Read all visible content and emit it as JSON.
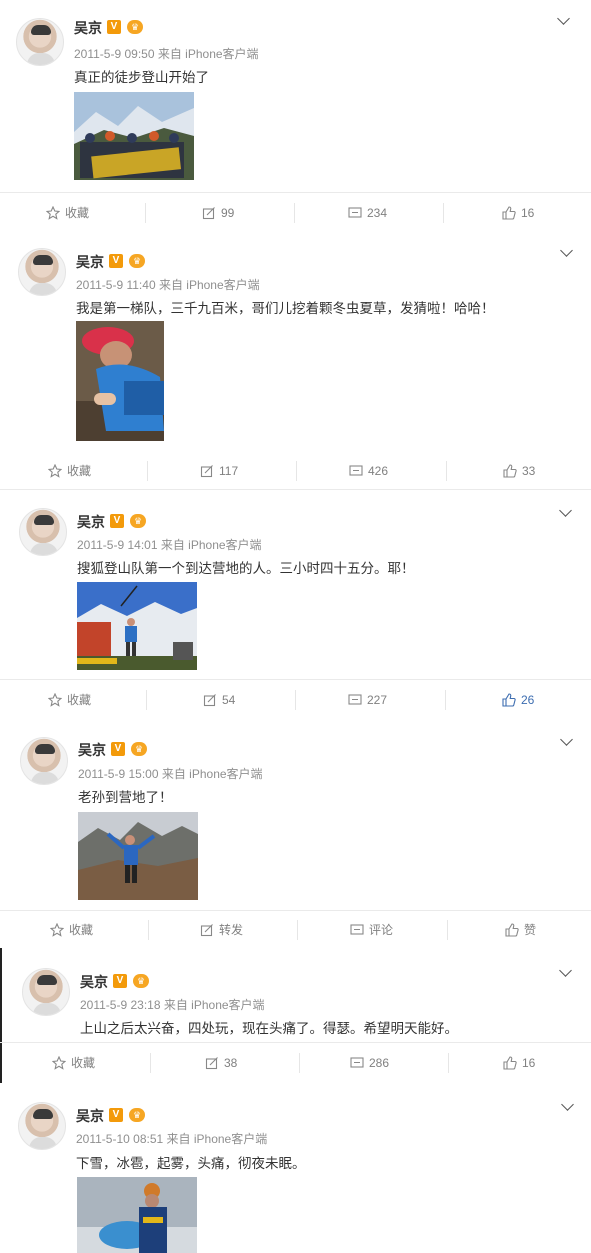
{
  "author_name": "吴京",
  "v_badge": "V",
  "crown_badge": "♛",
  "actions": {
    "favorite_label": "收藏",
    "repost_label": "转发",
    "comment_label": "评论",
    "like_label": "赞"
  },
  "colors": {
    "accent_blue": "#3d6db0",
    "v_badge": "#f39a0a",
    "meta_gray": "#8f8f8f"
  },
  "icons": [
    "star-icon",
    "repost-icon",
    "comment-icon",
    "like-icon",
    "chevron-down-icon",
    "verified-v-icon",
    "vip-crown-icon"
  ],
  "posts": [
    {
      "meta": "2011-5-9 09:50 来自 iPhone客户端",
      "text": "真正的徒步登山开始了",
      "repost": "99",
      "comment": "234",
      "like": "16",
      "like_active": false
    },
    {
      "meta": "2011-5-9 11:40 来自 iPhone客户端",
      "text": "我是第一梯队，三千九百米，哥们儿挖着颗冬虫夏草，发猜啦！哈哈！",
      "repost": "117",
      "comment": "426",
      "like": "33",
      "like_active": false
    },
    {
      "meta": "2011-5-9 14:01 来自 iPhone客户端",
      "text": "搜狐登山队第一个到达营地的人。三小时四十五分。耶！",
      "repost": "54",
      "comment": "227",
      "like": "26",
      "like_active": true
    },
    {
      "meta": "2011-5-9 15:00 来自 iPhone客户端",
      "text": "老孙到营地了！",
      "repost": "转发",
      "comment": "评论",
      "like": "赞",
      "like_active": false
    },
    {
      "meta": "2011-5-9 23:18 来自 iPhone客户端",
      "text": "上山之后太兴奋，四处玩，现在头痛了。得瑟。希望明天能好。",
      "repost": "38",
      "comment": "286",
      "like": "16",
      "like_active": false
    },
    {
      "meta": "2011-5-10 08:51 来自 iPhone客户端",
      "text": "下雪，冰雹，起雾，头痛，彻夜未眠。"
    }
  ]
}
